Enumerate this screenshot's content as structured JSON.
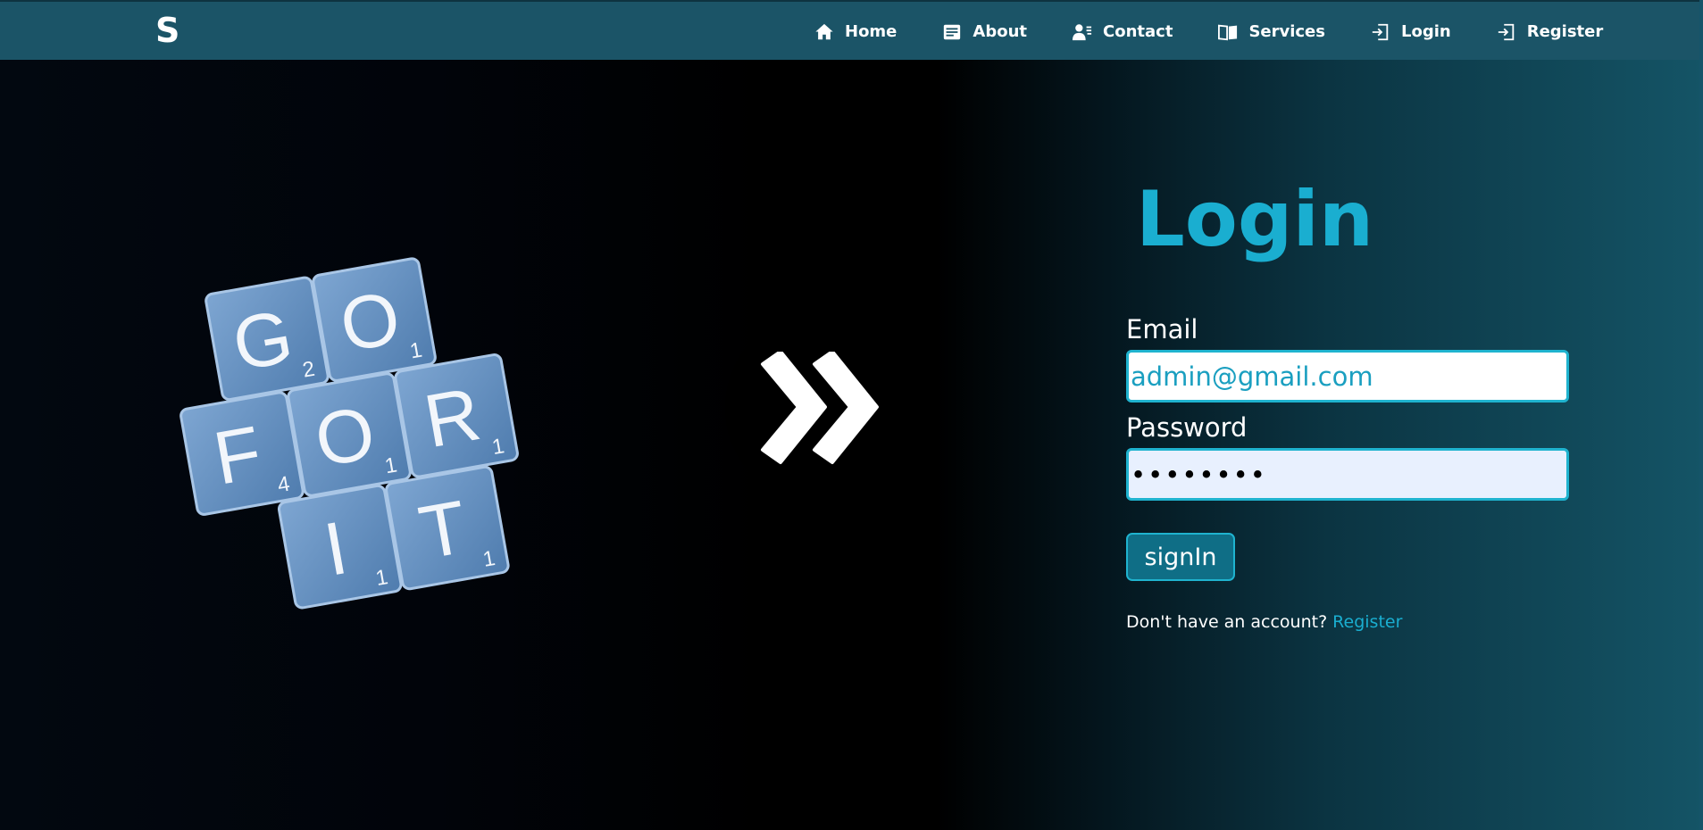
{
  "brand": "S",
  "nav": {
    "items": [
      {
        "label": "Home",
        "icon": "home-icon"
      },
      {
        "label": "About",
        "icon": "about-icon"
      },
      {
        "label": "Contact",
        "icon": "contact-icon"
      },
      {
        "label": "Services",
        "icon": "book-icon"
      },
      {
        "label": "Login",
        "icon": "login-icon"
      },
      {
        "label": "Register",
        "icon": "register-icon"
      }
    ]
  },
  "hero": {
    "tiles": [
      {
        "letter": "G",
        "score": "2"
      },
      {
        "letter": "O",
        "score": "1"
      },
      {
        "letter": "F",
        "score": "4"
      },
      {
        "letter": "O",
        "score": "1"
      },
      {
        "letter": "R",
        "score": "1"
      },
      {
        "letter": "I",
        "score": "1"
      },
      {
        "letter": "T",
        "score": "1"
      }
    ]
  },
  "form": {
    "title": "Login",
    "email_label": "Email",
    "email_value": "admin@gmail.com",
    "password_label": "Password",
    "password_value": "••••••••",
    "submit_label": "signIn",
    "account_prompt": "Don't have an account?",
    "register_link": "Register"
  },
  "colors": {
    "navbar": "#1b5467",
    "accent": "#1aaed0",
    "button": "#0f6e86"
  }
}
